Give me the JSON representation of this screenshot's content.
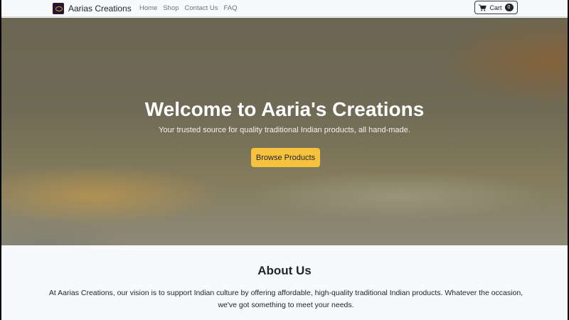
{
  "navbar": {
    "brand": "Aarias Creations",
    "links": [
      "Home",
      "Shop",
      "Contact Us",
      "FAQ"
    ],
    "cart_label": "Cart",
    "cart_count": "0"
  },
  "hero": {
    "title": "Welcome to Aaria's Creations",
    "subtitle": "Your trusted source for quality traditional Indian products, all hand-made.",
    "button_label": "Browse Products",
    "button_color": "#f6c23e"
  },
  "about": {
    "title": "About Us",
    "text": "At Aarias Creations, our vision is to support Indian culture by offering affordable, high-quality traditional Indian products. Whatever the occasion, we've got something to meet your needs."
  },
  "icons": {
    "cart": "shopping-cart-icon",
    "logo": "brand-logo-icon"
  }
}
